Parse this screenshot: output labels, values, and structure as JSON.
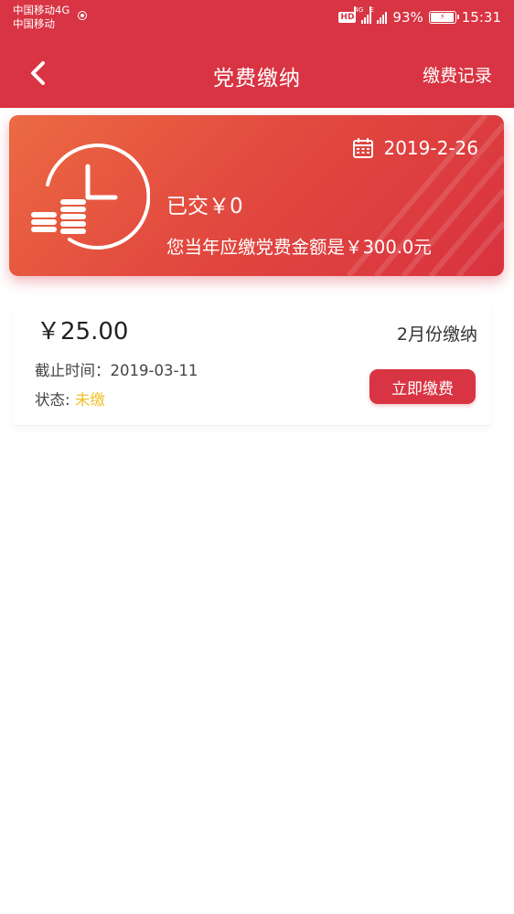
{
  "status_bar": {
    "carrier_line1": "中国移动4G",
    "carrier_line2": "中国移动",
    "hd_badge": "HD",
    "signal1_tag": "4G",
    "signal2_tag": "E",
    "battery_percent": "93%",
    "time": "15:31"
  },
  "header": {
    "back_icon": "chevron-left-icon",
    "title": "党费缴纳",
    "records_link": "缴费记录"
  },
  "summary": {
    "date": "2019-2-26",
    "paid_text": "已交￥0",
    "due_text": "您当年应缴党费金额是￥300.0元",
    "colors": {
      "card_start": "#ec6a42",
      "card_end": "#d8323f"
    }
  },
  "payment": {
    "amount": "￥25.00",
    "month": "2月份缴纳",
    "deadline_label": "截止时间：",
    "deadline_value": "2019-03-11",
    "status_label": "状态:",
    "status_value": "未缴",
    "pay_button": "立即缴费"
  },
  "theme": {
    "primary": "#d83443",
    "status_unpaid": "#f0c12b"
  }
}
